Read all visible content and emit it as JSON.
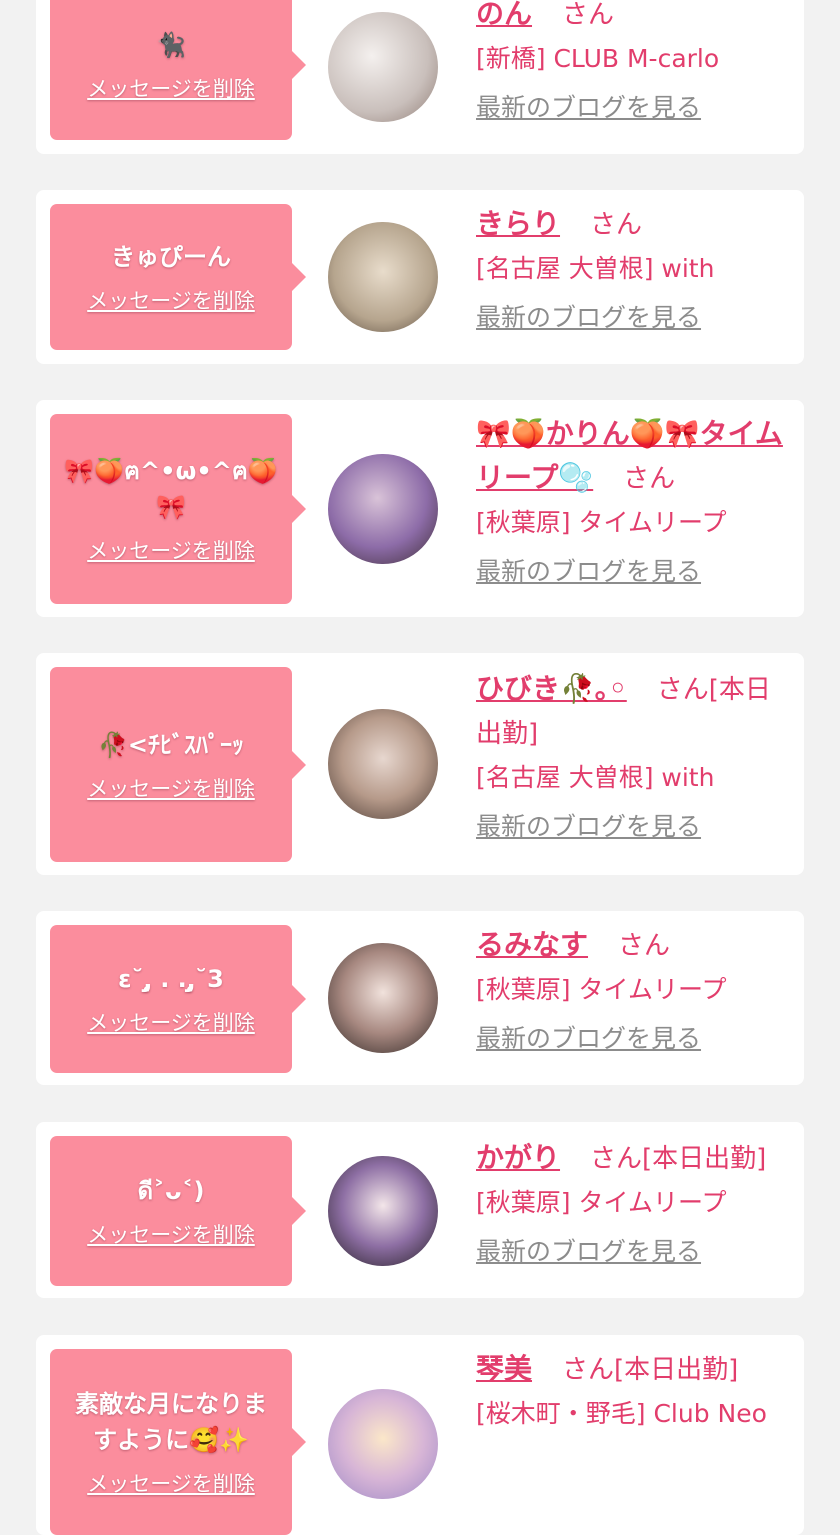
{
  "delete_label": "メッセージを削除",
  "blog_label": "最新のブログを見る",
  "suffix": "さん",
  "cards": [
    {
      "message": "🐈‍⬛",
      "name": "のん",
      "after_name": "",
      "shop": "[新橋] CLUB M-carlo"
    },
    {
      "message": "きゅぴーん",
      "name": "きらり",
      "after_name": "",
      "shop": "[名古屋 大曽根] with"
    },
    {
      "message": "🎀🍑ฅ^•ω•^ฅ🍑\n🎀",
      "name": "🎀🍑かりん🍑🎀タイムリープ🫧",
      "after_name": "",
      "shop": "[秋葉原] タイムリープ"
    },
    {
      "message": "🥀<ﾁﾋﾞｽﾊﾟｰｯ",
      "name": "ひびき🥀｡◦",
      "after_name": "[本日出勤]",
      "shop": "[名古屋 大曽根] with"
    },
    {
      "message": "ε˘ ̨̡ . . ̨̡˘3",
      "name": "るみなす",
      "after_name": "",
      "shop": "[秋葉原] タイムリープ"
    },
    {
      "message": "ดี˃ᴗ˂)",
      "name": "かがり",
      "after_name": "[本日出勤]",
      "shop": "[秋葉原] タイムリープ"
    },
    {
      "message": "素敵な月になりま\nすように🥰✨",
      "name": "琴美",
      "after_name": "[本日出勤]",
      "shop": "[桜木町・野毛] Club Neo"
    }
  ]
}
